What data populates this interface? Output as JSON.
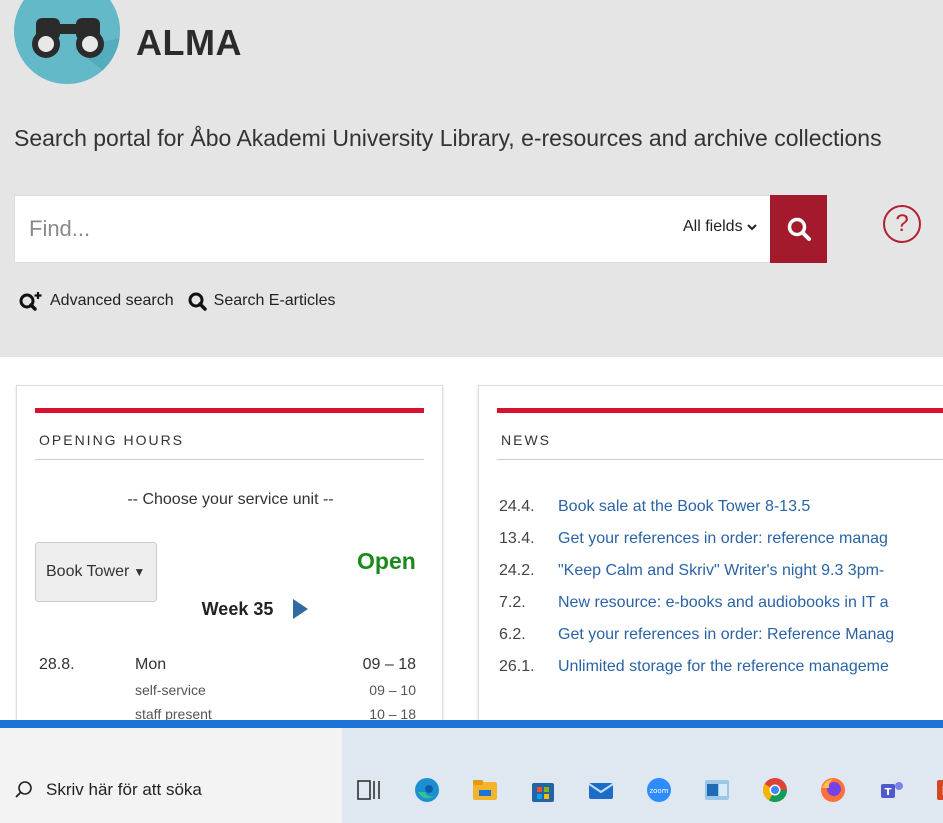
{
  "header": {
    "app_title": "ALMA",
    "tagline": "Search portal for Åbo Akademi University Library, e-resources and archive collections",
    "logo_icon": "binoculars-logo-icon",
    "logo_color": "#64b9c9"
  },
  "search": {
    "placeholder": "Find...",
    "field_select": "All fields",
    "search_icon": "search-icon",
    "help_icon": "question-circle-icon",
    "button_color": "#a31a2d"
  },
  "links": {
    "advanced_search": "Advanced search",
    "search_earticles": "Search E-articles"
  },
  "opening_hours": {
    "heading": "OPENING HOURS",
    "choose_unit": "-- Choose your service unit --",
    "selected_unit": "Book Tower",
    "status": "Open",
    "status_color": "#1a8a1a",
    "week_label": "Week 35",
    "rows": [
      {
        "date": "28.8.",
        "day": "Mon",
        "time": "09 – 18"
      },
      {
        "date": "",
        "day": "self-service",
        "time": "09 – 10"
      },
      {
        "date": "",
        "day": "staff present",
        "time": "10 – 18"
      }
    ]
  },
  "news": {
    "heading": "NEWS",
    "items": [
      {
        "date": "24.4.",
        "title": "Book sale at the Book Tower 8-13.5"
      },
      {
        "date": "13.4.",
        "title": "Get your references in order: reference manag"
      },
      {
        "date": "24.2.",
        "title": "\"Keep Calm and Skriv\" Writer's night 9.3 3pm-"
      },
      {
        "date": "7.2.",
        "title": "New resource: e-books and audiobooks in IT a"
      },
      {
        "date": "6.2.",
        "title": "Get your references in order: Reference Manag"
      },
      {
        "date": "26.1.",
        "title": "Unlimited storage for the reference manageme"
      }
    ]
  },
  "taskbar": {
    "search_text": "Skriv här för att söka",
    "icons": [
      "task-view-icon",
      "edge-icon",
      "file-explorer-icon",
      "microsoft-store-icon",
      "mail-icon",
      "zoom-icon",
      "outlook-icon",
      "chrome-icon",
      "firefox-icon",
      "teams-icon",
      "powerpoint-icon"
    ]
  },
  "accent_color": "#d6122e"
}
